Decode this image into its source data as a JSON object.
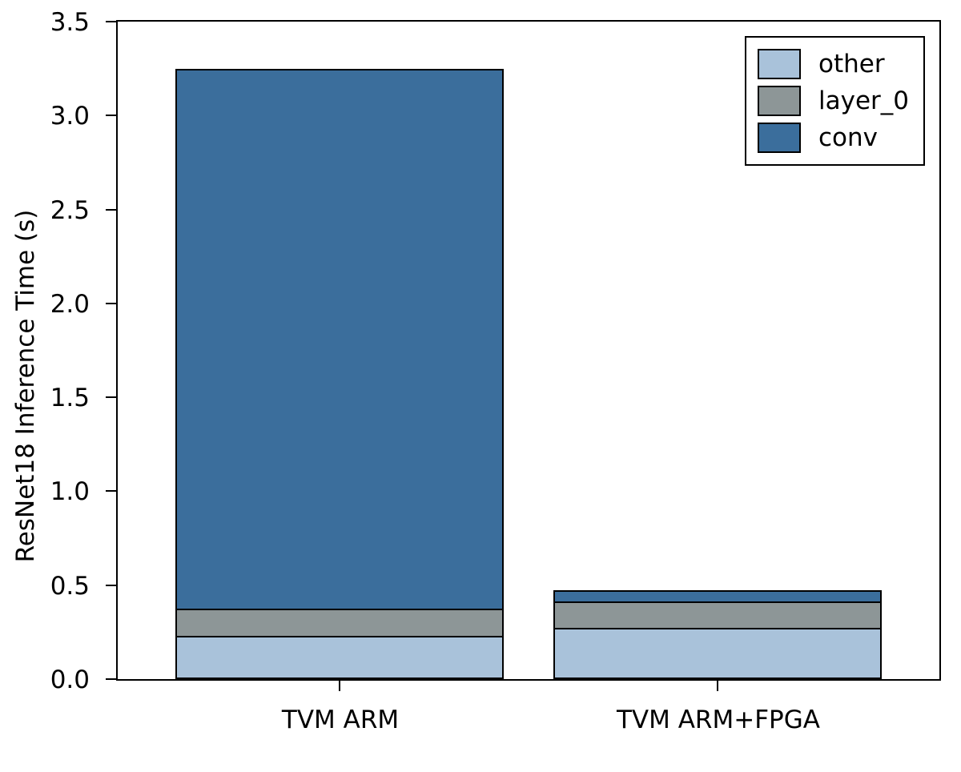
{
  "chart_data": {
    "type": "bar",
    "stacking": "stacked",
    "categories": [
      "TVM ARM",
      "TVM ARM+FPGA"
    ],
    "series": [
      {
        "name": "other",
        "values": [
          0.23,
          0.27
        ],
        "color": "#a9c2da"
      },
      {
        "name": "layer_0",
        "values": [
          0.15,
          0.15
        ],
        "color": "#8d9697"
      },
      {
        "name": "conv",
        "values": [
          2.87,
          0.07
        ],
        "color": "#3b6e9c"
      }
    ],
    "ylabel": "ResNet18 Inference Time (s)",
    "xlabel": "",
    "ylim": [
      0,
      3.5
    ],
    "yticks": [
      0.0,
      0.5,
      1.0,
      1.5,
      2.0,
      2.5,
      3.0,
      3.5
    ],
    "ytick_labels": [
      "0.0",
      "0.5",
      "1.0",
      "1.5",
      "2.0",
      "2.5",
      "3.0",
      "3.5"
    ],
    "legend_position": "upper right"
  }
}
